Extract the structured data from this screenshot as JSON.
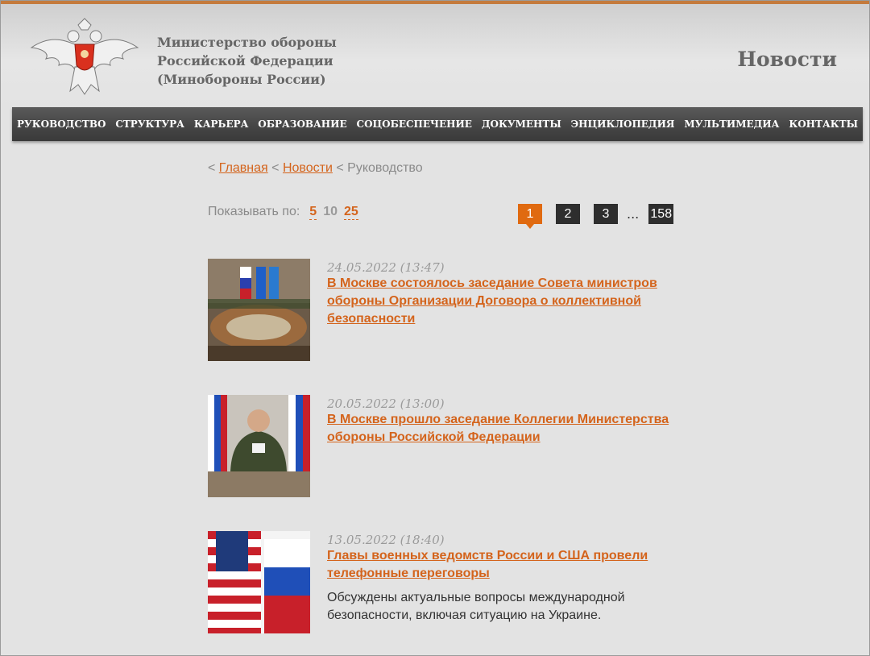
{
  "header": {
    "org_line1": "Министерство обороны",
    "org_line2": "Российской Федерации",
    "org_line3": "(Минобороны России)",
    "section": "Новости",
    "emblem_icon": "double-headed-eagle-emblem"
  },
  "nav": {
    "items": [
      {
        "label": "РУКОВОДСТВО"
      },
      {
        "label": "СТРУКТУРА"
      },
      {
        "label": "КАРЬЕРА"
      },
      {
        "label": "ОБРАЗОВАНИЕ"
      },
      {
        "label": "СОЦОБЕСПЕЧЕНИЕ"
      },
      {
        "label": "ДОКУМЕНТЫ"
      },
      {
        "label": "ЭНЦИКЛОПЕДИЯ"
      },
      {
        "label": "МУЛЬТИМЕДИА"
      },
      {
        "label": "КОНТАКТЫ"
      }
    ]
  },
  "breadcrumb": {
    "sep": "<",
    "home": "Главная",
    "news": "Новости",
    "current": "Руководство"
  },
  "perpage": {
    "label": "Показывать по:",
    "opt1": "5",
    "opt2": "10",
    "opt3": "25"
  },
  "pager": {
    "p1": "1",
    "p2": "2",
    "p3": "3",
    "dots": "...",
    "last": "158"
  },
  "news": [
    {
      "date": "24.05.2022 (13:47)",
      "title": "В Москве состоялось заседание Совета министров обороны Организации Договора о коллективной безопасности",
      "lead": ""
    },
    {
      "date": "20.05.2022 (13:00)",
      "title": "В Москве прошло заседание Коллегии Министерства обороны Российской Федерации",
      "lead": ""
    },
    {
      "date": "13.05.2022 (18:40)",
      "title": "Главы военных ведомств России и США провели телефонные переговоры",
      "lead": "Обсуждены актуальные вопросы международной безопасности, включая ситуацию на Украине."
    }
  ],
  "colors": {
    "accent": "#d4641c",
    "nav_bg": "#444444",
    "page_bg": "#e3e3e3"
  }
}
